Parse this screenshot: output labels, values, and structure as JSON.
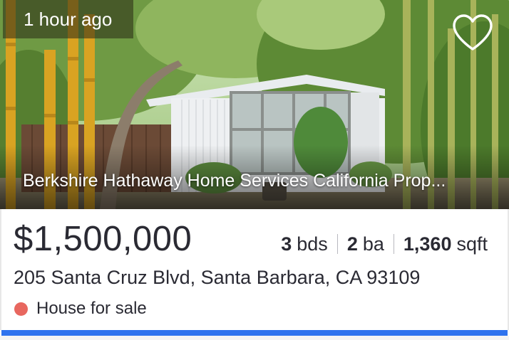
{
  "listing": {
    "time_posted": "1 hour ago",
    "broker": "Berkshire Hathaway Home Services California Prop...",
    "price": "$1,500,000",
    "facts": {
      "beds_value": "3",
      "beds_unit": "bds",
      "baths_value": "2",
      "baths_unit": "ba",
      "area_value": "1,360",
      "area_unit": "sqft"
    },
    "address": "205 Santa Cruz Blvd, Santa Barbara, CA 93109",
    "status": "House for sale",
    "favorite_icon": "heart-outline-icon"
  },
  "colors": {
    "status_dot": "#e8675f",
    "accent_bar": "#2f73ee",
    "text_primary": "#2a2a33"
  }
}
